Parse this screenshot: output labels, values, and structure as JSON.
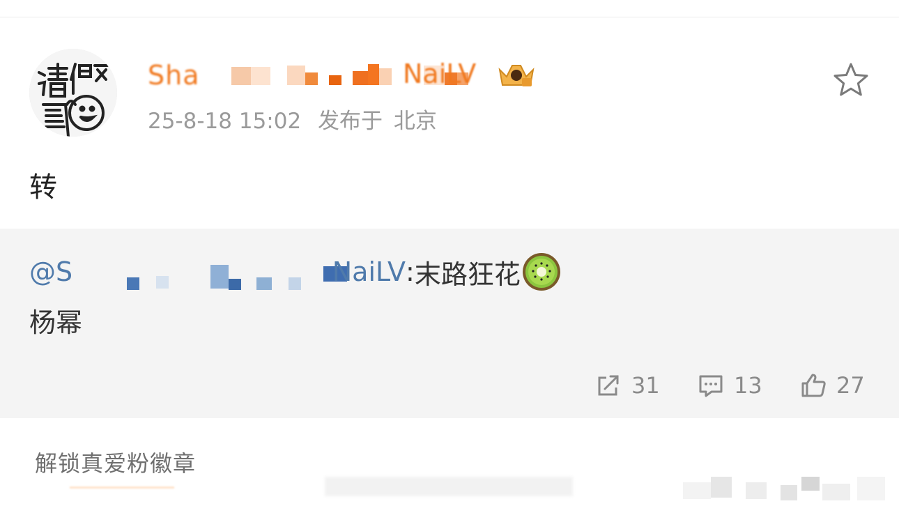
{
  "post": {
    "username": "Sha",
    "username_tail": "NaiLV",
    "badge_icon": "vip-crown-badge-icon",
    "timestamp": "25-8-18 15:02",
    "location_prefix": "发布于",
    "location": "北京",
    "text": "转"
  },
  "repost": {
    "at_prefix": "@S",
    "at_tail": "NaiLV",
    "separator": ":",
    "content": "末路狂花",
    "emoji": "kiwi-emoji-icon",
    "second_line": "杨幂"
  },
  "actions": {
    "share_count": "31",
    "comment_count": "13",
    "like_count": "27"
  },
  "footer": {
    "label": "解锁真爱粉徽章"
  },
  "colors": {
    "username": "#f0781e",
    "mention": "#4f7aab",
    "meta_text": "#9a9a9a",
    "repost_bg": "#f4f4f4"
  }
}
